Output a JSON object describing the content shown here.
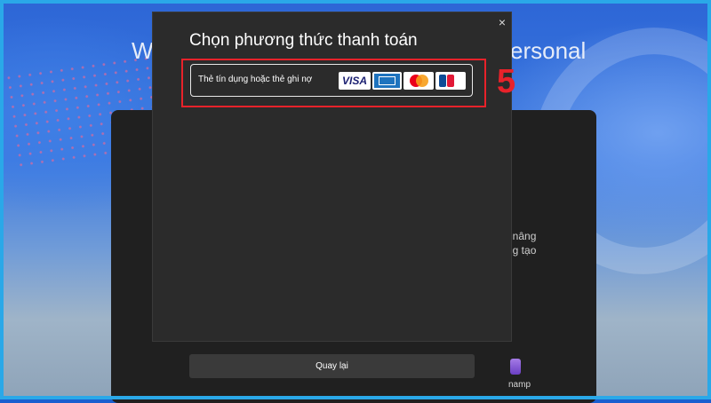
{
  "background": {
    "title_left": "W",
    "title_right": "ersonal",
    "side_text": [
      "t nâng",
      "ng tạo"
    ],
    "bottom_label": "namp"
  },
  "dialog": {
    "title": "Chọn phương thức thanh toán",
    "close_icon": "×",
    "payment_option": {
      "label": "Thẻ tín dụng hoặc thẻ ghi nợ",
      "logos": [
        "visa",
        "american-express",
        "mastercard",
        "jcb"
      ],
      "visa_text": "VISA"
    },
    "back_button": "Quay lại"
  },
  "annotation": {
    "step_number": "5",
    "color": "#e8222a"
  },
  "colors": {
    "dialog_bg": "#2b2b2b",
    "frame_border": "#2aa8e8"
  }
}
